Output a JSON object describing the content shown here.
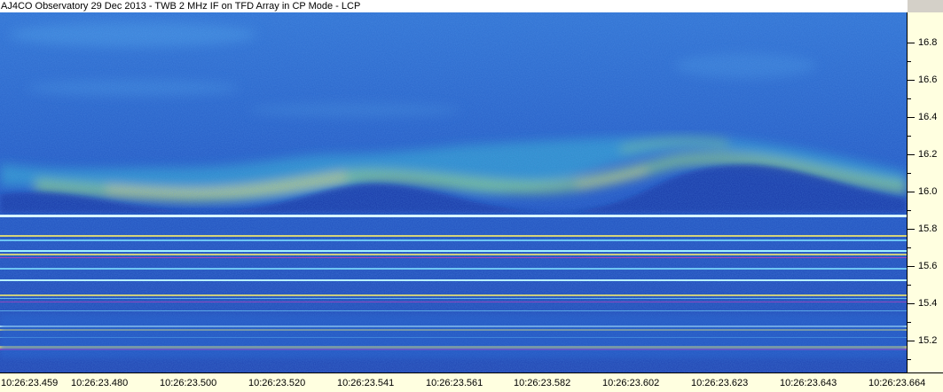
{
  "window": {
    "title": "AJ4CO Observatory 29 Dec 2013 - TWB 2 MHz IF on TFD Array in CP Mode - LCP"
  },
  "y_axis": {
    "labels": [
      "16.8",
      "16.6",
      "16.4",
      "16.2",
      "16.0",
      "15.8",
      "15.6",
      "15.4",
      "15.2"
    ]
  },
  "x_axis": {
    "labels": [
      "10:26:23.459",
      "10:26:23.480",
      "10:26:23.500",
      "10:26:23.520",
      "10:26:23.541",
      "10:26:23.561",
      "10:26:23.582",
      "10:26:23.602",
      "10:26:23.623",
      "10:26:23.643",
      "10:26:23.664"
    ]
  },
  "colors": {
    "background_blue": "#1a3fb0",
    "band_cyan": "#7fe0ff",
    "emission_yellow": "#e8e070",
    "emission_magenta": "#d040c0",
    "axis_bg": "#ffffe0"
  }
}
